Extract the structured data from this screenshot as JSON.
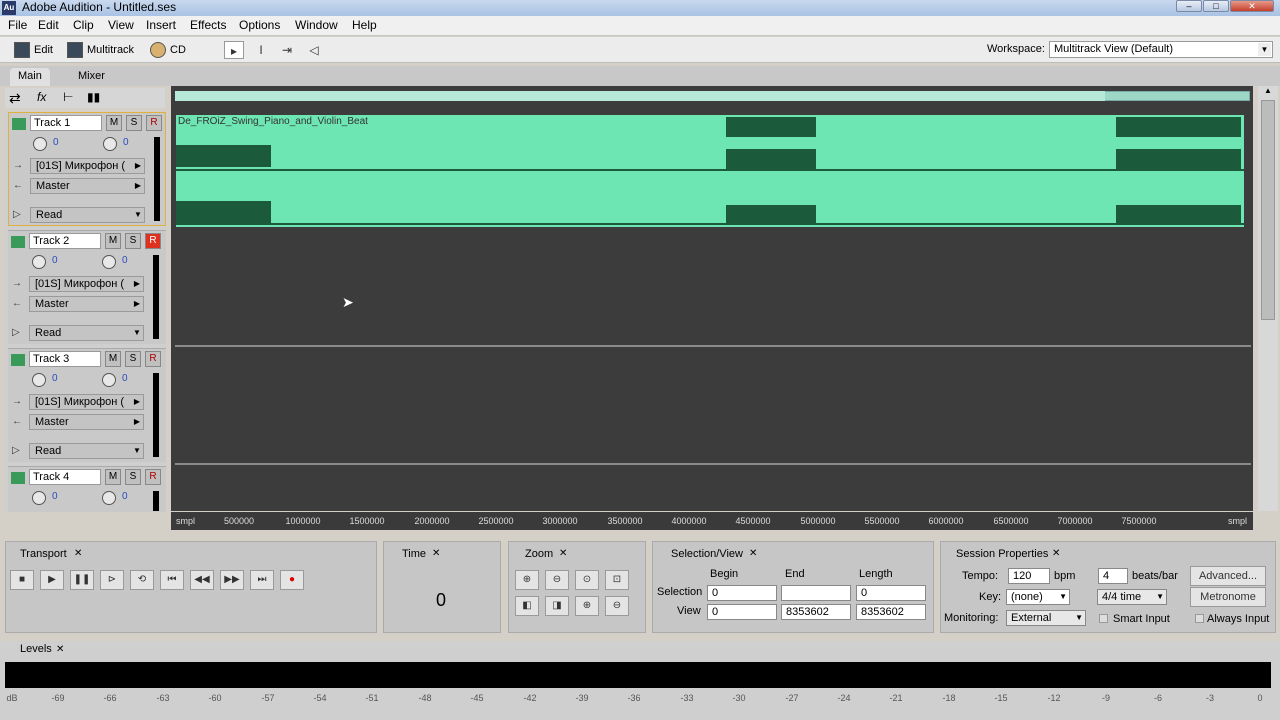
{
  "window": {
    "title": "Adobe Audition - Untitled.ses",
    "app_icon": "Au"
  },
  "menu": [
    "File",
    "Edit",
    "Clip",
    "View",
    "Insert",
    "Effects",
    "Options",
    "Window",
    "Help"
  ],
  "toolbar": {
    "edit": "Edit",
    "multitrack": "Multitrack",
    "cd": "CD",
    "workspace_label": "Workspace:",
    "workspace_value": "Multitrack View (Default)"
  },
  "panel_tabs": [
    "Main",
    "Mixer"
  ],
  "tracks": [
    {
      "name": "Track 1",
      "m": "M",
      "s": "S",
      "r": "R",
      "vol": "0",
      "pan": "0",
      "input": "[01S] Микрофон (",
      "output": "Master",
      "mode": "Read",
      "rec_armed": false
    },
    {
      "name": "Track 2",
      "m": "M",
      "s": "S",
      "r": "R",
      "vol": "0",
      "pan": "0",
      "input": "[01S] Микрофон (",
      "output": "Master",
      "mode": "Read",
      "rec_armed": true
    },
    {
      "name": "Track 3",
      "m": "M",
      "s": "S",
      "r": "R",
      "vol": "0",
      "pan": "0",
      "input": "[01S] Микрофон (",
      "output": "Master",
      "mode": "Read",
      "rec_armed": false
    },
    {
      "name": "Track 4",
      "m": "M",
      "s": "S",
      "r": "R",
      "vol": "0",
      "pan": "0"
    }
  ],
  "clip": {
    "name": "De_FROiZ_Swing_Piano_and_Violin_Beat",
    "color": "#6ee6b4"
  },
  "ruler": {
    "unit": "smpl",
    "ticks": [
      "500000",
      "1000000",
      "1500000",
      "2000000",
      "2500000",
      "3000000",
      "3500000",
      "4000000",
      "4500000",
      "5000000",
      "5500000",
      "6000000",
      "6500000",
      "7000000",
      "7500000"
    ]
  },
  "transport": {
    "title": "Transport"
  },
  "time": {
    "title": "Time",
    "value": "0"
  },
  "zoom": {
    "title": "Zoom"
  },
  "selection_view": {
    "title": "Selection/View",
    "begin_h": "Begin",
    "end_h": "End",
    "length_h": "Length",
    "sel_label": "Selection",
    "view_label": "View",
    "sel_begin": "0",
    "sel_end": "",
    "sel_length": "0",
    "view_begin": "0",
    "view_end": "8353602",
    "view_length": "8353602"
  },
  "session": {
    "title": "Session Properties",
    "tempo_label": "Tempo:",
    "tempo": "120",
    "bpm": "bpm",
    "beats": "4",
    "beats_label": "beats/bar",
    "advanced": "Advanced...",
    "key_label": "Key:",
    "key": "(none)",
    "time_sig": "4/4 time",
    "metronome": "Metronome",
    "monitoring_label": "Monitoring:",
    "monitoring": "External",
    "smart_input": "Smart Input",
    "always_input": "Always Input"
  },
  "levels": {
    "title": "Levels",
    "scale": [
      "dB",
      "-69",
      "-66",
      "-63",
      "-60",
      "-57",
      "-54",
      "-51",
      "-48",
      "-45",
      "-42",
      "-39",
      "-36",
      "-33",
      "-30",
      "-27",
      "-24",
      "-21",
      "-18",
      "-15",
      "-12",
      "-9",
      "-6",
      "-3",
      "0"
    ]
  }
}
